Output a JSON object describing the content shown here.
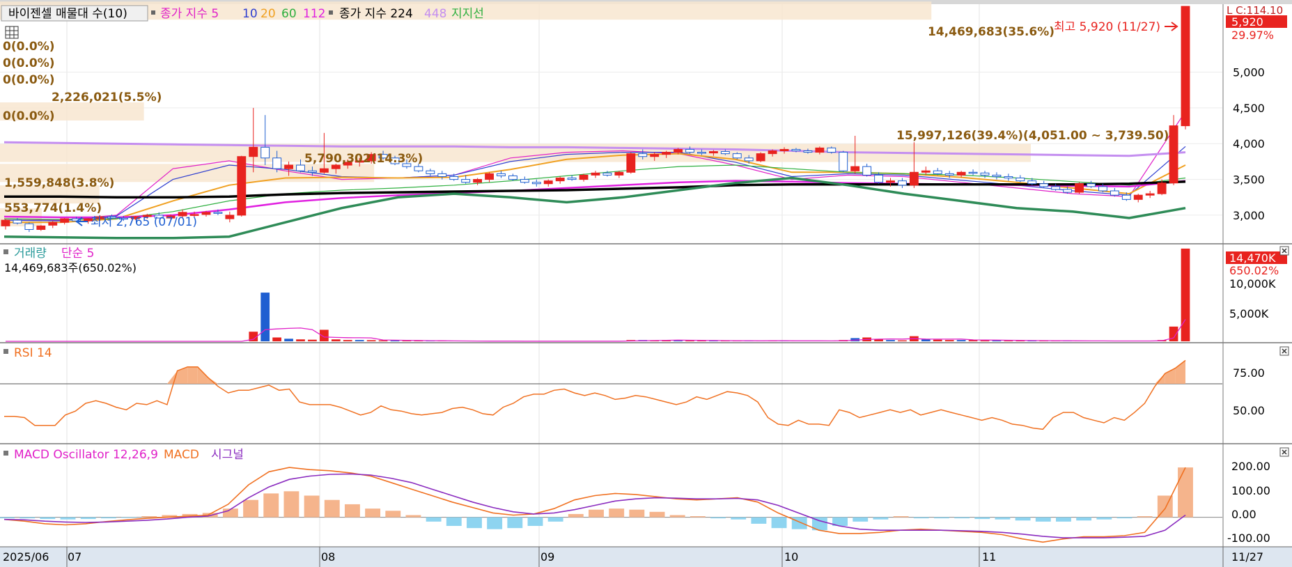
{
  "colors": {
    "up": "#e8231f",
    "down": "#1f5fd1",
    "ma5": "#e020c8",
    "ma10": "#2f3fd0",
    "ma20": "#f0a020",
    "ma60": "#2fb040",
    "ma112": "#e020e0",
    "ma224": "#000000",
    "ma448": "#c48ef0",
    "support": "#2e8b57",
    "volumeLabel": "#2a9a9a",
    "rsi": "#f07020",
    "macd": "#f07020",
    "signal": "#8a2bbf",
    "oscPos": "#f5b48c",
    "oscNeg": "#8ed4f0",
    "band": "#f8e6d0"
  },
  "price_panel": {
    "legend_label": "바이젠셀 매물대 수(10)",
    "ma_prefix": "종가 지수 5",
    "ma_values": [
      "10",
      "20",
      "60",
      "112"
    ],
    "ma224_label": "종가 지수 224",
    "ma448_label": "448",
    "support_label": "지지선",
    "high_annotation": "최고 5,920 (11/27)",
    "low_annotation": "최저 2,765 (07/01)",
    "current_price": "5,920",
    "current_change": "29.97%",
    "corner_label": "L C:114.10",
    "profile_labels": [
      "14,469,683(35.6%)",
      "0(0.0%)",
      "0(0.0%)",
      "0(0.0%)",
      "2,226,021(5.5%)",
      "0(0.0%)",
      "15,997,126(39.4%)(4,051.00 ~ 3,739.50)",
      "5,790,302(14.3%)",
      "1,559,848(3.8%)",
      "553,774(1.4%)"
    ],
    "y_ticks": [
      "5,000",
      "4,500",
      "4,000",
      "3,500",
      "3,000"
    ]
  },
  "volume_panel": {
    "title": "거래량",
    "ma_label": "단순 5",
    "info": "14,469,683주(650.02%)",
    "current": "14,470K",
    "change": "650.02%",
    "y_ticks": [
      "10,000K",
      "5,000K"
    ]
  },
  "rsi_panel": {
    "title": "RSI 14",
    "y_ticks": [
      "75.00",
      "50.00"
    ]
  },
  "macd_panel": {
    "osc_label": "MACD Oscillator 12,26,9",
    "macd_label": "MACD",
    "signal_label": "시그널",
    "y_ticks": [
      "200.00",
      "100.00",
      "0.00",
      "-100.00"
    ]
  },
  "x_axis": {
    "labels": [
      "2025/06",
      "07",
      "08",
      "09",
      "10",
      "11"
    ],
    "right_label": "11/27"
  },
  "chart_data": {
    "type": "candlestick",
    "price_range": [
      2600,
      5950
    ],
    "current_price": 5920,
    "high": {
      "value": 5920,
      "date": "11/27"
    },
    "low": {
      "value": 2765,
      "date": "07/01"
    },
    "candles_ohlc_sample": [
      [
        2850,
        2950,
        2800,
        2930
      ],
      [
        2930,
        2960,
        2870,
        2890
      ],
      [
        2880,
        2900,
        2765,
        2800
      ],
      [
        2800,
        2860,
        2780,
        2850
      ],
      [
        2860,
        2920,
        2820,
        2900
      ],
      [
        2900,
        2960,
        2870,
        2950
      ],
      [
        2950,
        2980,
        2900,
        2920
      ],
      [
        2920,
        2960,
        2880,
        2950
      ],
      [
        2950,
        3000,
        2920,
        2980
      ],
      [
        2980,
        3010,
        2940,
        2960
      ],
      [
        2960,
        2990,
        2920,
        2950
      ],
      [
        2950,
        2990,
        2930,
        2980
      ],
      [
        2980,
        3020,
        2950,
        3000
      ],
      [
        3000,
        3040,
        2970,
        2960
      ],
      [
        2960,
        3010,
        2930,
        2990
      ],
      [
        2990,
        3080,
        2960,
        3040
      ],
      [
        3000,
        3050,
        2970,
        3010
      ],
      [
        3010,
        3060,
        2980,
        3040
      ],
      [
        3040,
        3080,
        3000,
        3030
      ],
      [
        2950,
        3050,
        2900,
        3000
      ],
      [
        3000,
        3830,
        2980,
        3820
      ],
      [
        3820,
        4500,
        3600,
        3950
      ],
      [
        3950,
        4400,
        3700,
        3800
      ],
      [
        3800,
        3900,
        3600,
        3650
      ],
      [
        3650,
        3750,
        3550,
        3700
      ],
      [
        3700,
        3780,
        3600,
        3620
      ],
      [
        3620,
        3680,
        3550,
        3600
      ],
      [
        3600,
        4150,
        3580,
        3650
      ],
      [
        3650,
        3720,
        3580,
        3700
      ],
      [
        3700,
        3780,
        3650,
        3740
      ],
      [
        3740,
        3800,
        3680,
        3760
      ],
      [
        3760,
        3880,
        3720,
        3850
      ],
      [
        3850,
        3900,
        3780,
        3800
      ],
      [
        3800,
        3830,
        3700,
        3720
      ],
      [
        3720,
        3780,
        3650,
        3680
      ],
      [
        3680,
        3720,
        3600,
        3620
      ],
      [
        3620,
        3650,
        3550,
        3580
      ],
      [
        3580,
        3620,
        3500,
        3540
      ],
      [
        3540,
        3580,
        3480,
        3500
      ],
      [
        3500,
        3560,
        3440,
        3460
      ],
      [
        3460,
        3520,
        3420,
        3500
      ],
      [
        3500,
        3600,
        3460,
        3580
      ],
      [
        3580,
        3620,
        3520,
        3550
      ],
      [
        3550,
        3580,
        3480,
        3500
      ],
      [
        3500,
        3540,
        3440,
        3460
      ],
      [
        3460,
        3500,
        3400,
        3440
      ],
      [
        3440,
        3500,
        3400,
        3480
      ],
      [
        3480,
        3540,
        3440,
        3520
      ],
      [
        3520,
        3560,
        3480,
        3500
      ],
      [
        3500,
        3580,
        3470,
        3560
      ],
      [
        3560,
        3620,
        3520,
        3590
      ],
      [
        3590,
        3620,
        3540,
        3560
      ],
      [
        3560,
        3620,
        3520,
        3600
      ],
      [
        3600,
        3880,
        3580,
        3860
      ],
      [
        3860,
        3920,
        3780,
        3820
      ],
      [
        3820,
        3880,
        3760,
        3850
      ],
      [
        3850,
        3900,
        3800,
        3880
      ],
      [
        3880,
        3940,
        3850,
        3920
      ],
      [
        3920,
        3960,
        3860,
        3880
      ],
      [
        3880,
        3920,
        3840,
        3870
      ],
      [
        3870,
        3910,
        3830,
        3890
      ],
      [
        3890,
        3920,
        3840,
        3860
      ],
      [
        3860,
        3880,
        3780,
        3800
      ],
      [
        3800,
        3840,
        3720,
        3760
      ],
      [
        3760,
        3880,
        3740,
        3860
      ],
      [
        3860,
        3920,
        3820,
        3900
      ],
      [
        3900,
        3950,
        3860,
        3920
      ],
      [
        3920,
        3940,
        3880,
        3900
      ],
      [
        3900,
        3930,
        3860,
        3880
      ],
      [
        3880,
        3960,
        3850,
        3940
      ],
      [
        3940,
        3960,
        3860,
        3880
      ],
      [
        3880,
        3900,
        3600,
        3620
      ],
      [
        3620,
        4110,
        3580,
        3680
      ],
      [
        3680,
        3720,
        3540,
        3560
      ],
      [
        3560,
        3600,
        3440,
        3460
      ],
      [
        3460,
        3520,
        3400,
        3480
      ],
      [
        3480,
        3520,
        3380,
        3420
      ],
      [
        3420,
        4020,
        3380,
        3600
      ],
      [
        3600,
        3680,
        3560,
        3620
      ],
      [
        3620,
        3660,
        3560,
        3580
      ],
      [
        3580,
        3620,
        3520,
        3560
      ],
      [
        3560,
        3620,
        3530,
        3600
      ],
      [
        3600,
        3640,
        3560,
        3590
      ],
      [
        3590,
        3620,
        3520,
        3560
      ],
      [
        3560,
        3600,
        3500,
        3540
      ],
      [
        3540,
        3580,
        3480,
        3520
      ],
      [
        3520,
        3560,
        3460,
        3480
      ],
      [
        3480,
        3520,
        3420,
        3440
      ],
      [
        3440,
        3480,
        3380,
        3400
      ],
      [
        3400,
        3440,
        3340,
        3360
      ],
      [
        3360,
        3400,
        3300,
        3320
      ],
      [
        3320,
        3460,
        3300,
        3440
      ],
      [
        3440,
        3480,
        3380,
        3400
      ],
      [
        3400,
        3440,
        3320,
        3340
      ],
      [
        3340,
        3380,
        3260,
        3280
      ],
      [
        3280,
        3320,
        3200,
        3220
      ],
      [
        3220,
        3300,
        3180,
        3280
      ],
      [
        3280,
        3340,
        3240,
        3300
      ],
      [
        3300,
        3500,
        3280,
        3450
      ],
      [
        3450,
        4400,
        3420,
        4250
      ],
      [
        4250,
        5920,
        4200,
        5920
      ]
    ],
    "series": [
      {
        "name": "5",
        "values": [
          2950,
          2930,
          3000,
          3650,
          3760,
          3620,
          3500,
          3520,
          3560,
          3800,
          3880,
          3900,
          3860,
          3700,
          3500,
          3560,
          3540,
          3460,
          3380,
          3300,
          3260,
          4450
        ]
      },
      {
        "name": "10",
        "values": [
          2930,
          2920,
          2990,
          3500,
          3700,
          3640,
          3540,
          3520,
          3560,
          3750,
          3850,
          3880,
          3880,
          3740,
          3540,
          3580,
          3560,
          3490,
          3420,
          3340,
          3280,
          3960
        ]
      },
      {
        "name": "20",
        "values": [
          2900,
          2900,
          2950,
          3200,
          3420,
          3520,
          3530,
          3520,
          3530,
          3640,
          3780,
          3840,
          3860,
          3780,
          3600,
          3600,
          3580,
          3530,
          3460,
          3380,
          3300,
          3700
        ]
      },
      {
        "name": "60",
        "values": [
          2950,
          2940,
          2950,
          3050,
          3200,
          3300,
          3350,
          3380,
          3420,
          3480,
          3550,
          3620,
          3680,
          3700,
          3650,
          3600,
          3580,
          3560,
          3520,
          3470,
          3420,
          3520
        ]
      },
      {
        "name": "112",
        "values": [
          2980,
          2970,
          2970,
          3000,
          3080,
          3180,
          3240,
          3280,
          3310,
          3340,
          3380,
          3420,
          3460,
          3480,
          3470,
          3450,
          3440,
          3430,
          3420,
          3410,
          3400,
          3480
        ]
      },
      {
        "name": "224",
        "values": [
          3260,
          3260,
          3250,
          3250,
          3260,
          3290,
          3310,
          3320,
          3330,
          3340,
          3350,
          3370,
          3390,
          3420,
          3430,
          3430,
          3430,
          3430,
          3430,
          3430,
          3440,
          3470
        ]
      },
      {
        "name": "448",
        "values": [
          4020,
          4010,
          4000,
          3990,
          3980,
          3970,
          3960,
          3960,
          3960,
          3950,
          3950,
          3940,
          3930,
          3920,
          3900,
          3880,
          3870,
          3860,
          3850,
          3840,
          3830,
          3880
        ]
      },
      {
        "name": "지지선",
        "values": [
          2700,
          2690,
          2680,
          2680,
          2700,
          2900,
          3100,
          3250,
          3300,
          3250,
          3180,
          3250,
          3350,
          3450,
          3520,
          3420,
          3300,
          3200,
          3100,
          3050,
          2960,
          3100
        ]
      }
    ],
    "volume_profile": [
      {
        "label": "14,469,683(35.6%)",
        "price": 5870,
        "share": 35.6
      },
      {
        "label": "2,226,021(5.5%)",
        "price": 4460,
        "share": 5.5
      },
      {
        "label": "15,997,126(39.4%)",
        "price": 3880,
        "share": 39.4
      },
      {
        "label": "5,790,302(14.3%)",
        "price": 3600,
        "share": 14.3
      },
      {
        "label": "1,559,848(3.8%)",
        "price": 3300,
        "share": 3.8
      },
      {
        "label": "553,774(1.4%)",
        "price": 2980,
        "share": 1.4
      }
    ],
    "volume": {
      "ylim": [
        0,
        15000000
      ],
      "values_sample": [
        0,
        0,
        0,
        0,
        0,
        0,
        0,
        0,
        0,
        0,
        0,
        0,
        0,
        0,
        0,
        0,
        0,
        0,
        0,
        0,
        0,
        1500000,
        7600000,
        600000,
        400000,
        300000,
        250000,
        1800000,
        300000,
        200000,
        200000,
        180000,
        150000,
        120000,
        100000,
        80000,
        60000,
        50000,
        40000,
        40000,
        30000,
        30000,
        20000,
        20000,
        20000,
        20000,
        20000,
        20000,
        20000,
        20000,
        20000,
        20000,
        20000,
        200000,
        200000,
        150000,
        200000,
        150000,
        120000,
        100000,
        80000,
        80000,
        80000,
        80000,
        80000,
        100000,
        80000,
        60000,
        60000,
        60000,
        60000,
        200000,
        500000,
        600000,
        300000,
        200000,
        150000,
        800000,
        300000,
        250000,
        200000,
        200000,
        200000,
        150000,
        150000,
        100000,
        100000,
        100000,
        80000,
        80000,
        60000,
        60000,
        60000,
        50000,
        50000,
        50000,
        50000,
        80000,
        200000,
        2300000,
        14469683
      ]
    },
    "rsi": {
      "ylim": [
        25,
        100
      ],
      "values": [
        45,
        45,
        44,
        38,
        38,
        38,
        46,
        49,
        55,
        57,
        55,
        52,
        50,
        55,
        54,
        57,
        54,
        80,
        83,
        83,
        75,
        68,
        63,
        65,
        65,
        67,
        69,
        65,
        66,
        56,
        54,
        54,
        54,
        52,
        49,
        46,
        48,
        53,
        50,
        49,
        47,
        46,
        47,
        48,
        51,
        52,
        50,
        47,
        46,
        52,
        55,
        60,
        62,
        62,
        65,
        66,
        63,
        61,
        63,
        61,
        58,
        59,
        61,
        60,
        58,
        56,
        54,
        56,
        60,
        58,
        61,
        64,
        63,
        61,
        56,
        44,
        39,
        38,
        42,
        39,
        39,
        38,
        50,
        48,
        44,
        46,
        48,
        50,
        48,
        50,
        46,
        48,
        50,
        48,
        46,
        44,
        42,
        44,
        42,
        39,
        38,
        36,
        35,
        44,
        48,
        48,
        44,
        42,
        40,
        44,
        42,
        48,
        55,
        68,
        78,
        82,
        88
      ]
    },
    "macd": {
      "ylim": [
        -130,
        330
      ],
      "macd": [
        -10,
        -18,
        -30,
        -35,
        -30,
        -20,
        -12,
        -5,
        0,
        5,
        10,
        60,
        150,
        210,
        230,
        220,
        215,
        205,
        190,
        160,
        130,
        100,
        70,
        45,
        20,
        10,
        15,
        40,
        80,
        100,
        110,
        105,
        95,
        85,
        80,
        85,
        90,
        70,
        20,
        -20,
        -60,
        -75,
        -75,
        -70,
        -60,
        -55,
        -60,
        -65,
        -70,
        -80,
        -100,
        -115,
        -100,
        -90,
        -90,
        -85,
        -70,
        40,
        230
      ],
      "signal": [
        -10,
        -12,
        -18,
        -22,
        -24,
        -22,
        -18,
        -14,
        -8,
        0,
        5,
        30,
        90,
        140,
        175,
        190,
        198,
        200,
        195,
        180,
        160,
        130,
        100,
        70,
        45,
        25,
        15,
        20,
        35,
        55,
        75,
        85,
        90,
        88,
        85,
        85,
        87,
        80,
        55,
        20,
        -15,
        -40,
        -55,
        -60,
        -60,
        -60,
        -60,
        -62,
        -65,
        -70,
        -78,
        -88,
        -95,
        -95,
        -95,
        -92,
        -88,
        -60,
        10
      ],
      "oscillator": [
        -5,
        -5,
        -8,
        -10,
        -8,
        -5,
        -3,
        5,
        10,
        15,
        20,
        40,
        80,
        110,
        120,
        100,
        80,
        60,
        40,
        30,
        10,
        -20,
        -40,
        -50,
        -55,
        -50,
        -40,
        -20,
        15,
        35,
        40,
        35,
        25,
        10,
        5,
        -5,
        -10,
        -30,
        -50,
        -55,
        -60,
        -40,
        -20,
        -10,
        5,
        -5,
        -5,
        -5,
        -8,
        -10,
        -15,
        -20,
        -20,
        -15,
        -10,
        -5,
        5,
        100,
        230
      ]
    }
  }
}
